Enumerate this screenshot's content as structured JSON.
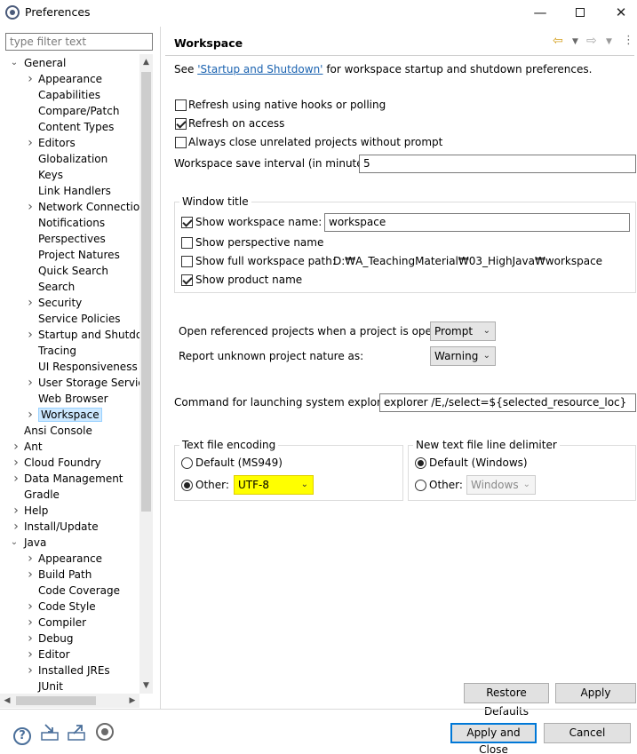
{
  "window": {
    "title": "Preferences",
    "min_icon": "minimize-icon",
    "max_icon": "maximize-icon",
    "close_icon": "close-icon"
  },
  "filter": {
    "placeholder": "type filter text",
    "value": ""
  },
  "tree": [
    {
      "label": "General",
      "expanded": true
    },
    {
      "label": "Appearance",
      "arrow": true
    },
    {
      "label": "Capabilities"
    },
    {
      "label": "Compare/Patch"
    },
    {
      "label": "Content Types"
    },
    {
      "label": "Editors",
      "arrow": true
    },
    {
      "label": "Globalization"
    },
    {
      "label": "Keys"
    },
    {
      "label": "Link Handlers"
    },
    {
      "label": "Network Connection",
      "arrow": true
    },
    {
      "label": "Notifications"
    },
    {
      "label": "Perspectives"
    },
    {
      "label": "Project Natures"
    },
    {
      "label": "Quick Search"
    },
    {
      "label": "Search"
    },
    {
      "label": "Security",
      "arrow": true
    },
    {
      "label": "Service Policies"
    },
    {
      "label": "Startup and Shutdow",
      "arrow": true
    },
    {
      "label": "Tracing"
    },
    {
      "label": "UI Responsiveness M"
    },
    {
      "label": "User Storage Service",
      "arrow": true
    },
    {
      "label": "Web Browser"
    },
    {
      "label": "Workspace",
      "arrow": true,
      "selected": true
    },
    {
      "label": "Ansi Console"
    },
    {
      "label": "Ant",
      "arrow": true
    },
    {
      "label": "Cloud Foundry",
      "arrow": true
    },
    {
      "label": "Data Management",
      "arrow": true
    },
    {
      "label": "Gradle"
    },
    {
      "label": "Help",
      "arrow": true
    },
    {
      "label": "Install/Update",
      "arrow": true
    },
    {
      "label": "Java",
      "expanded": true
    },
    {
      "label": "Appearance",
      "arrow": true
    },
    {
      "label": "Build Path",
      "arrow": true
    },
    {
      "label": "Code Coverage"
    },
    {
      "label": "Code Style",
      "arrow": true
    },
    {
      "label": "Compiler",
      "arrow": true
    },
    {
      "label": "Debug",
      "arrow": true
    },
    {
      "label": "Editor",
      "arrow": true
    },
    {
      "label": "Installed JREs",
      "arrow": true
    },
    {
      "label": "JUnit"
    }
  ],
  "page": {
    "title": "Workspace",
    "see_prefix": "See",
    "see_link": "'Startup and Shutdown'",
    "see_suffix": "for workspace startup and shutdown preferences.",
    "refresh_native": {
      "label": "Refresh using native hooks or polling",
      "checked": false
    },
    "refresh_access": {
      "label": "Refresh on access",
      "checked": true
    },
    "always_close": {
      "label": "Always close unrelated projects without prompt",
      "checked": false
    },
    "save_interval_label": "Workspace save interval (in minutes):",
    "save_interval_value": "5",
    "window_title_group": "Window title",
    "show_ws_name": {
      "label": "Show workspace name:",
      "checked": true,
      "value": "workspace"
    },
    "show_perspective": {
      "label": "Show perspective name",
      "checked": false
    },
    "show_full_path": {
      "label": "Show full workspace path:",
      "checked": false,
      "value": "D:₩A_TeachingMaterial₩03_HighJava₩workspace"
    },
    "show_product": {
      "label": "Show product name",
      "checked": true
    },
    "open_ref_label": "Open referenced projects when a project is opened:",
    "open_ref_value": "Prompt",
    "unknown_nature_label": "Report unknown project nature as:",
    "unknown_nature_value": "Warning",
    "cmd_label": "Command for launching system explorer:",
    "cmd_value": "explorer /E,/select=${selected_resource_loc}",
    "encoding_group": "Text file encoding",
    "enc_default": {
      "label": "Default (MS949)",
      "checked": false
    },
    "enc_other": {
      "label": "Other:",
      "checked": true,
      "value": "UTF-8"
    },
    "delimiter_group": "New text file line delimiter",
    "delim_default": {
      "label": "Default (Windows)",
      "checked": true
    },
    "delim_other": {
      "label": "Other:",
      "checked": false,
      "value": "Windows"
    },
    "restore_defaults": "Restore Defaults",
    "apply": "Apply"
  },
  "footer": {
    "apply_close": "Apply and Close",
    "cancel": "Cancel"
  },
  "colors": {
    "highlight": "#ffff00",
    "selection": "#cce8ff",
    "link": "#1a62b0",
    "default_button_border": "#0078d7"
  }
}
